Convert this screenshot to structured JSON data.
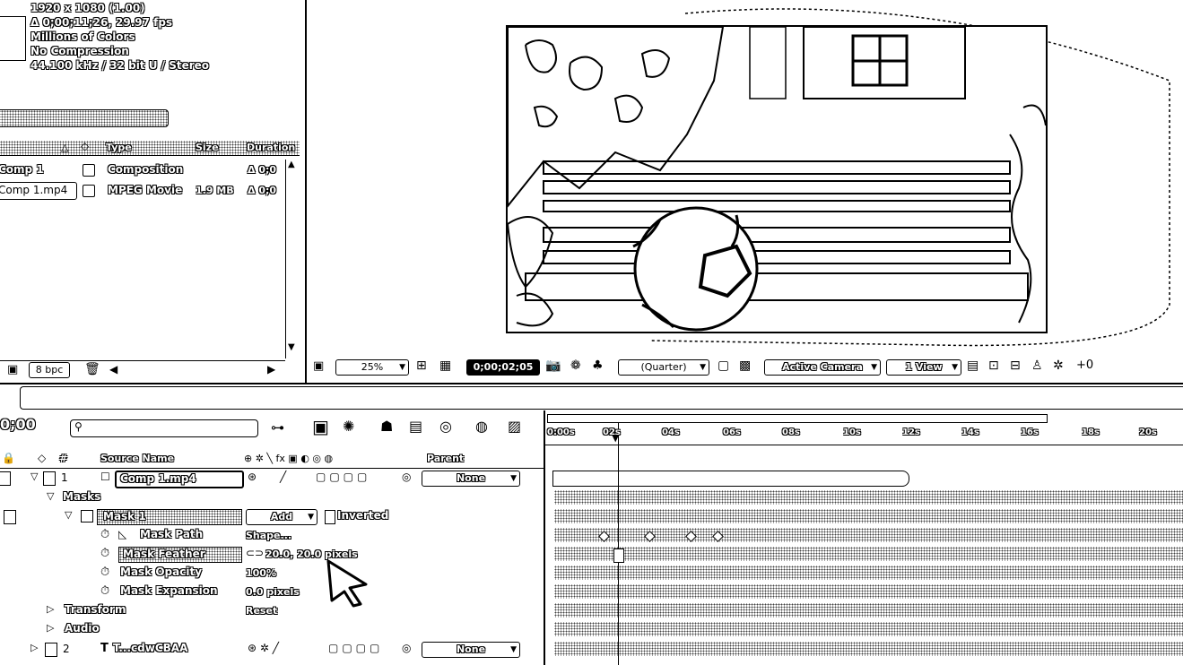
{
  "project": {
    "info_lines": [
      "1920 x 1080 (1.00)",
      "Δ 0;00;11;26, 29.97 fps",
      "Millions of Colors",
      "No Compression",
      "44.100 kHz / 32 bit U / Stereo"
    ],
    "columns": {
      "type": "Type",
      "size": "Size",
      "duration": "Duration"
    },
    "items": [
      {
        "name": "Comp 1",
        "type": "Composition",
        "size": "",
        "duration": "Δ 0;0"
      },
      {
        "name": "Comp 1.mp4",
        "type": "MPEG Movie",
        "size": "1.9 MB",
        "duration": "Δ 0;0"
      }
    ],
    "bpc": "8 bpc"
  },
  "viewer": {
    "zoom": "25%",
    "timecode": "0;00;02;05",
    "resolution": "(Quarter)",
    "camera": "Active Camera",
    "views": "1 View"
  },
  "timeline": {
    "search_placeholder": "",
    "columns": {
      "source_name": "Source Name",
      "parent": "Parent"
    },
    "ticks": [
      "0:00s",
      "02s",
      "04s",
      "06s",
      "08s",
      "10s",
      "12s",
      "14s",
      "16s",
      "18s",
      "20s"
    ],
    "layers": [
      {
        "num": "1",
        "name": "Comp 1.mp4",
        "parent": "None"
      },
      {
        "num": "2",
        "name": "T...cdwCBAA",
        "parent": "None"
      }
    ],
    "props": {
      "masks": "Masks",
      "mask1": "Mask 1",
      "mode": "Add",
      "inverted": "Inverted",
      "mask_path": "Mask Path",
      "mask_path_val": "Shape...",
      "mask_feather": "Mask Feather",
      "mask_feather_val": "20.0, 20.0 pixels",
      "mask_opacity": "Mask Opacity",
      "mask_opacity_val": "100%",
      "mask_expansion": "Mask Expansion",
      "mask_expansion_val": "0.0 pixels",
      "transform": "Transform",
      "transform_val": "Reset",
      "audio": "Audio"
    }
  }
}
